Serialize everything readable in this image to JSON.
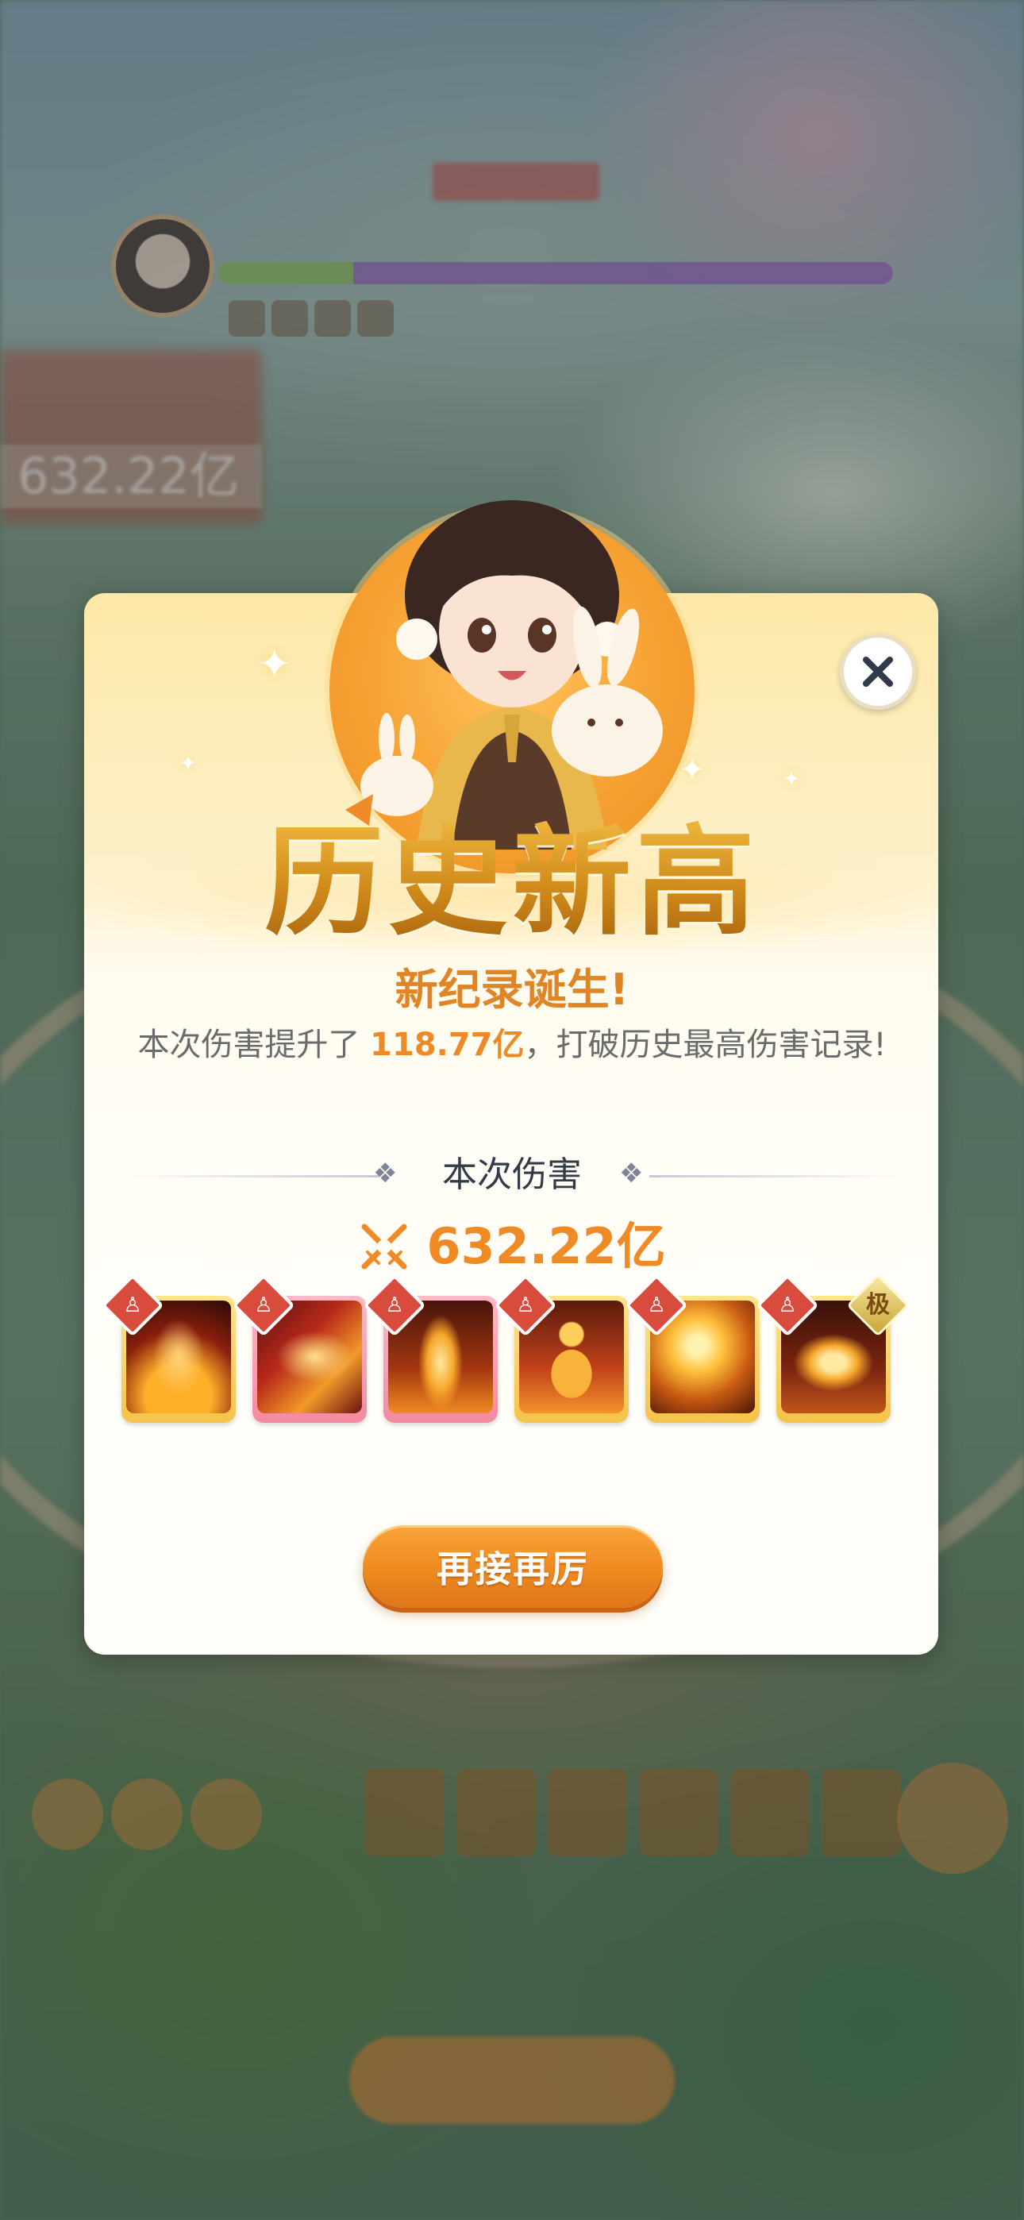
{
  "hud": {
    "damage_display": "632.22亿"
  },
  "dialog": {
    "headline": "历史新高",
    "subtitle": "新纪录诞生!",
    "description": {
      "prefix": "本次伤害提升了 ",
      "increase": "118.77亿",
      "suffix": "，打破历史最高伤害记录!"
    },
    "section_title": "本次伤害",
    "damage_value": "632.22亿",
    "skills": [
      {
        "name": "fire-figure-skill",
        "frame": "gold",
        "rank": ""
      },
      {
        "name": "phoenix-skill",
        "frame": "pink",
        "rank": ""
      },
      {
        "name": "pagoda-skill",
        "frame": "pink",
        "rank": ""
      },
      {
        "name": "buddha-skill",
        "frame": "gold",
        "rank": ""
      },
      {
        "name": "fire-orb-skill",
        "frame": "gold",
        "rank": ""
      },
      {
        "name": "lotus-skill",
        "frame": "gold",
        "rank": "极"
      }
    ],
    "retry_button": "再接再厉"
  },
  "colors": {
    "accent_orange": "#ef8a25",
    "headline_gold": "#d08a1a",
    "badge_red": "#d94b3c"
  }
}
